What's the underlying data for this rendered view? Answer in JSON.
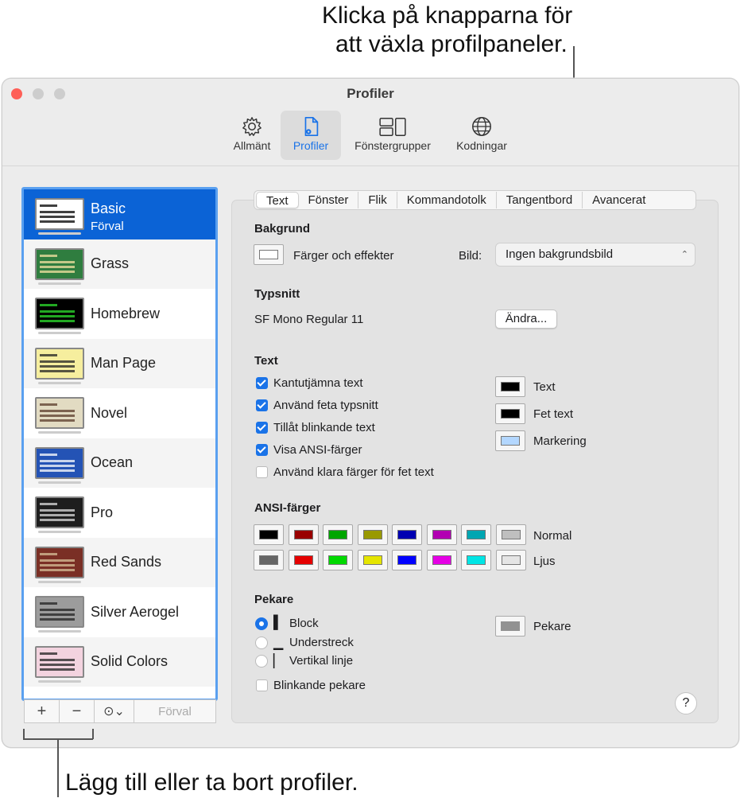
{
  "callouts": {
    "top_line1": "Klicka på knapparna för",
    "top_line2": "att växla profilpaneler.",
    "bottom": "Lägg till eller ta bort profiler."
  },
  "window": {
    "title": "Profiler",
    "toolbar": [
      {
        "label": "Allmänt",
        "icon": "gear-icon"
      },
      {
        "label": "Profiler",
        "icon": "profile-doc-icon",
        "active": true
      },
      {
        "label": "Fönstergrupper",
        "icon": "window-groups-icon"
      },
      {
        "label": "Kodningar",
        "icon": "globe-icon"
      }
    ]
  },
  "profiles": [
    {
      "name": "Basic",
      "subtitle": "Förval",
      "selected": true,
      "bg": "#ffffff",
      "fg": "#000000"
    },
    {
      "name": "Grass",
      "bg": "#2f7d3f",
      "fg": "#f5e3a3"
    },
    {
      "name": "Homebrew",
      "bg": "#000000",
      "fg": "#2ee02e"
    },
    {
      "name": "Man Page",
      "bg": "#f6ee9e",
      "fg": "#222222"
    },
    {
      "name": "Novel",
      "bg": "#e2dbc2",
      "fg": "#5a3b2a"
    },
    {
      "name": "Ocean",
      "bg": "#2453b5",
      "fg": "#ffffff"
    },
    {
      "name": "Pro",
      "bg": "#1e1e1e",
      "fg": "#dddddd"
    },
    {
      "name": "Red Sands",
      "bg": "#7a2f25",
      "fg": "#d8c19a"
    },
    {
      "name": "Silver Aerogel",
      "bg": "#9c9c9c",
      "fg": "#222222"
    },
    {
      "name": "Solid Colors",
      "bg": "#f3d3df",
      "fg": "#222222"
    }
  ],
  "bottom_bar": {
    "add": "+",
    "remove": "−",
    "more": "⊙⌄",
    "default": "Förval"
  },
  "tabs": [
    "Text",
    "Fönster",
    "Flik",
    "Kommandotolk",
    "Tangentbord",
    "Avancerat"
  ],
  "background": {
    "heading": "Bakgrund",
    "colors_label": "Färger och effekter",
    "image_label": "Bild:",
    "image_value": "Ingen bakgrundsbild"
  },
  "font": {
    "heading": "Typsnitt",
    "value": "SF Mono Regular 11",
    "change_button": "Ändra..."
  },
  "text": {
    "heading": "Text",
    "options": [
      {
        "label": "Kantutjämna text",
        "checked": true
      },
      {
        "label": "Använd feta typsnitt",
        "checked": true
      },
      {
        "label": "Tillåt blinkande text",
        "checked": true
      },
      {
        "label": "Visa ANSI-färger",
        "checked": true
      },
      {
        "label": "Använd klara färger för fet text",
        "checked": false
      }
    ],
    "colors": [
      {
        "label": "Text",
        "color": "#000000"
      },
      {
        "label": "Fet text",
        "color": "#000000"
      },
      {
        "label": "Markering",
        "color": "#b3d7ff"
      }
    ]
  },
  "ansi": {
    "heading": "ANSI-färger",
    "normal_label": "Normal",
    "bright_label": "Ljus",
    "normal": [
      "#000000",
      "#990000",
      "#00a600",
      "#999900",
      "#0000b2",
      "#b200b2",
      "#00a6b2",
      "#bfbfbf"
    ],
    "bright": [
      "#666666",
      "#e50000",
      "#00d900",
      "#e5e500",
      "#0000ff",
      "#e500e5",
      "#00e5e5",
      "#e5e5e5"
    ]
  },
  "cursor": {
    "heading": "Pekare",
    "options": [
      {
        "label": "Block",
        "glyph": "▌",
        "selected": true
      },
      {
        "label": "Understreck",
        "glyph": "▁",
        "selected": false
      },
      {
        "label": "Vertikal linje",
        "glyph": "▏",
        "selected": false
      }
    ],
    "blink_label": "Blinkande pekare",
    "color_label": "Pekare",
    "color": "#929292"
  },
  "help": "?"
}
